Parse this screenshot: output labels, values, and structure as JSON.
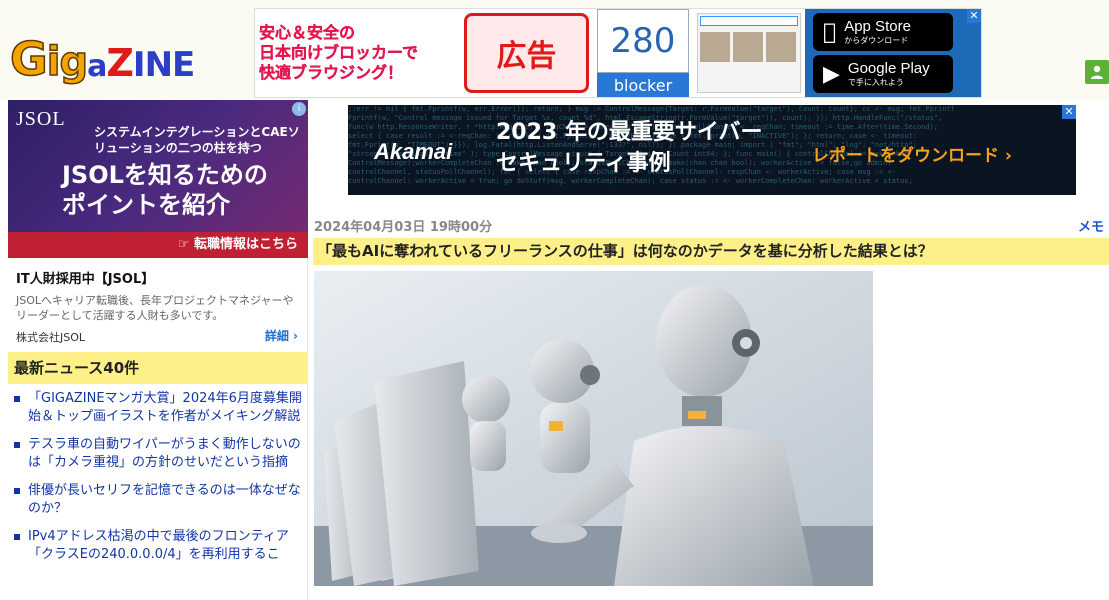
{
  "site": {
    "logo_text": "GigaZINE"
  },
  "header_ad": {
    "tagline_lines": [
      "安心＆安全の",
      "日本向けブロッカーで",
      "快適ブラウジング！"
    ],
    "badge": "広告",
    "app_number": "280",
    "app_label": "blocker",
    "app_store_label": "App Store",
    "app_store_sub": "からダウンロード",
    "google_play_label": "Google Play",
    "google_play_sub": "で手に入れよう",
    "close_label": "✕"
  },
  "left_ad": {
    "brand": "JSOL",
    "subtitle": "システムインテグレーションとCAEソリューションの二つの柱を持つ",
    "headline_line1": "JSOLを知るための",
    "headline_line2": "ポイントを紹介",
    "banner": "転職情報はこちら",
    "info_icon": "i"
  },
  "job_card": {
    "title": "IT人財採用中【JSOL】",
    "description": "JSOLへキャリア転職後、長年プロジェクトマネジャーやリーダーとして活躍する人財も多いです。",
    "company": "株式会社JSOL",
    "detail_link": "詳細 ›"
  },
  "news": {
    "heading": "最新ニュース40件",
    "items": [
      "「GIGAZINEマンガ大賞」2024年6月度募集開始＆トップ画イラストを作者がメイキング解説",
      "テスラ車の自動ワイパーがうまく動作しないのは「カメラ重視」の方針のせいだという指摘",
      "俳優が長いセリフを記憶できるのは一体なぜなのか？",
      "IPv4アドレス枯渇の中で最後のフロンティア「クラスEの240.0.0.0/4」を再利用するこ"
    ]
  },
  "banner_ad": {
    "logo": "Akamai",
    "headline_line1": "2023 年の最重要サイバー",
    "headline_line2": "セキュリティ事例",
    "cta": "レポートをダウンロード ›",
    "close_label": "✕"
  },
  "article": {
    "date": "2024年04月03日 19時00分",
    "category": "メモ",
    "title": "「最もAIに奪われているフリーランスの仕事」は何なのかデータを基に分析した結果とは？"
  },
  "colors": {
    "highlight_yellow": "#fdf088",
    "link_blue": "#1235a5",
    "user_green": "#5bb035"
  }
}
